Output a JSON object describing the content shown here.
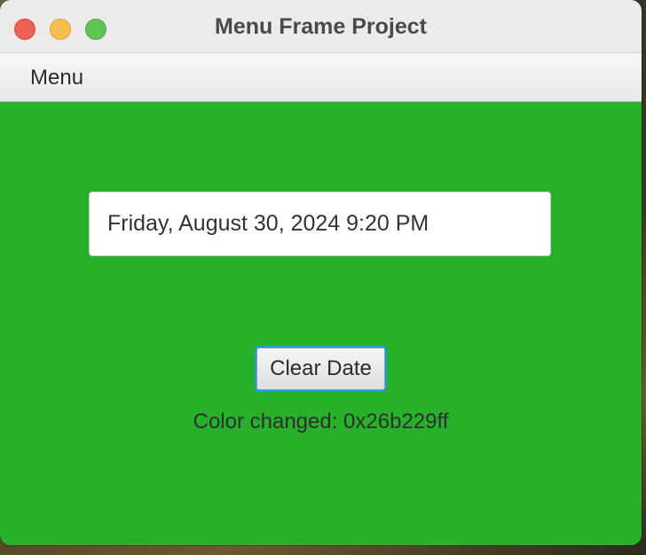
{
  "window": {
    "title": "Menu Frame Project"
  },
  "menubar": {
    "items": [
      {
        "label": "Menu"
      }
    ]
  },
  "main": {
    "date_field_value": "Friday, August 30, 2024 9:20 PM",
    "clear_button_label": "Clear Date",
    "status_text": "Color changed: 0x26b229ff",
    "background_color": "#26b229"
  },
  "colors": {
    "content_background": "#26b229",
    "focus_ring": "#1a9de2",
    "close": "#ee5f58",
    "minimize": "#f6be4f",
    "maximize": "#5fc454"
  }
}
